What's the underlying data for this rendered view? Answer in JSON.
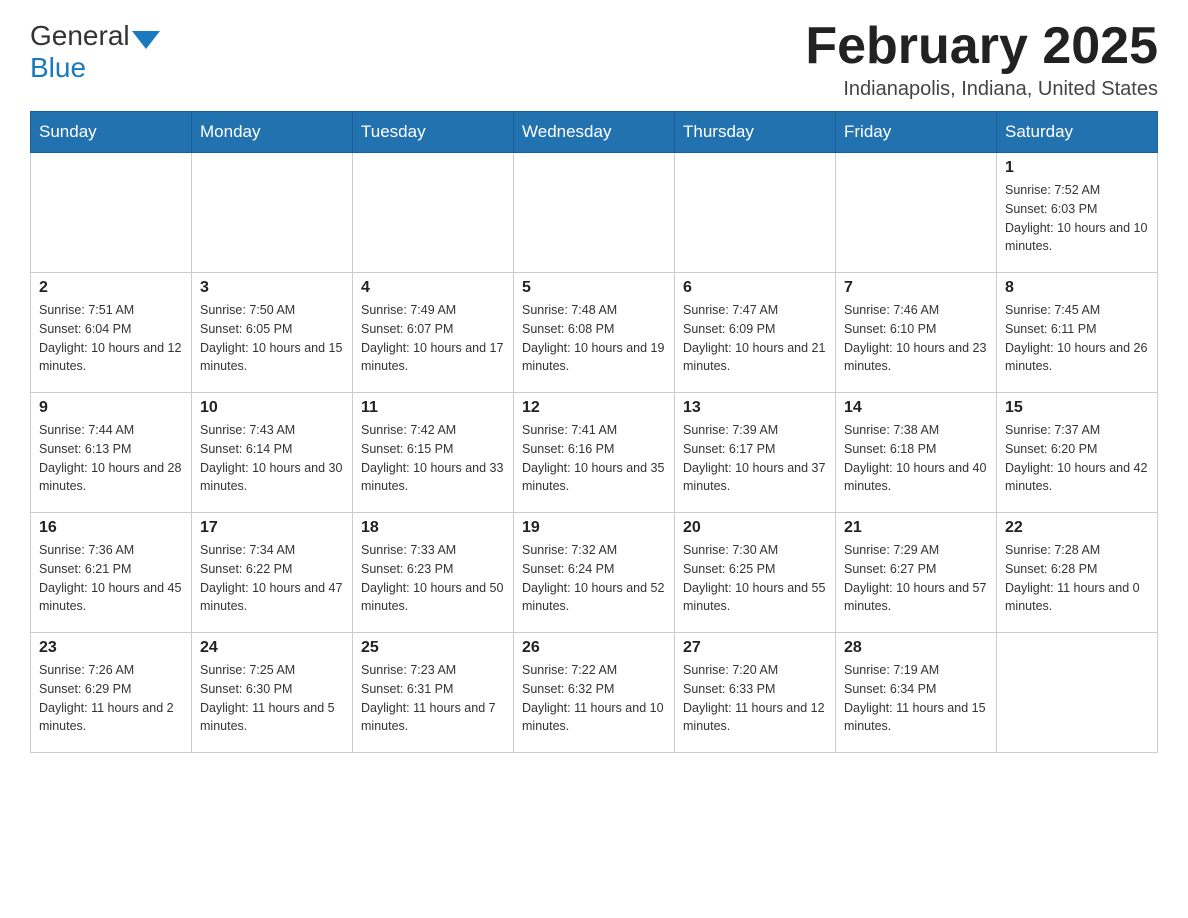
{
  "header": {
    "logo_general": "General",
    "logo_blue": "Blue",
    "month_title": "February 2025",
    "location": "Indianapolis, Indiana, United States"
  },
  "weekdays": [
    "Sunday",
    "Monday",
    "Tuesday",
    "Wednesday",
    "Thursday",
    "Friday",
    "Saturday"
  ],
  "weeks": [
    [
      {
        "day": "",
        "sunrise": "",
        "sunset": "",
        "daylight": ""
      },
      {
        "day": "",
        "sunrise": "",
        "sunset": "",
        "daylight": ""
      },
      {
        "day": "",
        "sunrise": "",
        "sunset": "",
        "daylight": ""
      },
      {
        "day": "",
        "sunrise": "",
        "sunset": "",
        "daylight": ""
      },
      {
        "day": "",
        "sunrise": "",
        "sunset": "",
        "daylight": ""
      },
      {
        "day": "",
        "sunrise": "",
        "sunset": "",
        "daylight": ""
      },
      {
        "day": "1",
        "sunrise": "Sunrise: 7:52 AM",
        "sunset": "Sunset: 6:03 PM",
        "daylight": "Daylight: 10 hours and 10 minutes."
      }
    ],
    [
      {
        "day": "2",
        "sunrise": "Sunrise: 7:51 AM",
        "sunset": "Sunset: 6:04 PM",
        "daylight": "Daylight: 10 hours and 12 minutes."
      },
      {
        "day": "3",
        "sunrise": "Sunrise: 7:50 AM",
        "sunset": "Sunset: 6:05 PM",
        "daylight": "Daylight: 10 hours and 15 minutes."
      },
      {
        "day": "4",
        "sunrise": "Sunrise: 7:49 AM",
        "sunset": "Sunset: 6:07 PM",
        "daylight": "Daylight: 10 hours and 17 minutes."
      },
      {
        "day": "5",
        "sunrise": "Sunrise: 7:48 AM",
        "sunset": "Sunset: 6:08 PM",
        "daylight": "Daylight: 10 hours and 19 minutes."
      },
      {
        "day": "6",
        "sunrise": "Sunrise: 7:47 AM",
        "sunset": "Sunset: 6:09 PM",
        "daylight": "Daylight: 10 hours and 21 minutes."
      },
      {
        "day": "7",
        "sunrise": "Sunrise: 7:46 AM",
        "sunset": "Sunset: 6:10 PM",
        "daylight": "Daylight: 10 hours and 23 minutes."
      },
      {
        "day": "8",
        "sunrise": "Sunrise: 7:45 AM",
        "sunset": "Sunset: 6:11 PM",
        "daylight": "Daylight: 10 hours and 26 minutes."
      }
    ],
    [
      {
        "day": "9",
        "sunrise": "Sunrise: 7:44 AM",
        "sunset": "Sunset: 6:13 PM",
        "daylight": "Daylight: 10 hours and 28 minutes."
      },
      {
        "day": "10",
        "sunrise": "Sunrise: 7:43 AM",
        "sunset": "Sunset: 6:14 PM",
        "daylight": "Daylight: 10 hours and 30 minutes."
      },
      {
        "day": "11",
        "sunrise": "Sunrise: 7:42 AM",
        "sunset": "Sunset: 6:15 PM",
        "daylight": "Daylight: 10 hours and 33 minutes."
      },
      {
        "day": "12",
        "sunrise": "Sunrise: 7:41 AM",
        "sunset": "Sunset: 6:16 PM",
        "daylight": "Daylight: 10 hours and 35 minutes."
      },
      {
        "day": "13",
        "sunrise": "Sunrise: 7:39 AM",
        "sunset": "Sunset: 6:17 PM",
        "daylight": "Daylight: 10 hours and 37 minutes."
      },
      {
        "day": "14",
        "sunrise": "Sunrise: 7:38 AM",
        "sunset": "Sunset: 6:18 PM",
        "daylight": "Daylight: 10 hours and 40 minutes."
      },
      {
        "day": "15",
        "sunrise": "Sunrise: 7:37 AM",
        "sunset": "Sunset: 6:20 PM",
        "daylight": "Daylight: 10 hours and 42 minutes."
      }
    ],
    [
      {
        "day": "16",
        "sunrise": "Sunrise: 7:36 AM",
        "sunset": "Sunset: 6:21 PM",
        "daylight": "Daylight: 10 hours and 45 minutes."
      },
      {
        "day": "17",
        "sunrise": "Sunrise: 7:34 AM",
        "sunset": "Sunset: 6:22 PM",
        "daylight": "Daylight: 10 hours and 47 minutes."
      },
      {
        "day": "18",
        "sunrise": "Sunrise: 7:33 AM",
        "sunset": "Sunset: 6:23 PM",
        "daylight": "Daylight: 10 hours and 50 minutes."
      },
      {
        "day": "19",
        "sunrise": "Sunrise: 7:32 AM",
        "sunset": "Sunset: 6:24 PM",
        "daylight": "Daylight: 10 hours and 52 minutes."
      },
      {
        "day": "20",
        "sunrise": "Sunrise: 7:30 AM",
        "sunset": "Sunset: 6:25 PM",
        "daylight": "Daylight: 10 hours and 55 minutes."
      },
      {
        "day": "21",
        "sunrise": "Sunrise: 7:29 AM",
        "sunset": "Sunset: 6:27 PM",
        "daylight": "Daylight: 10 hours and 57 minutes."
      },
      {
        "day": "22",
        "sunrise": "Sunrise: 7:28 AM",
        "sunset": "Sunset: 6:28 PM",
        "daylight": "Daylight: 11 hours and 0 minutes."
      }
    ],
    [
      {
        "day": "23",
        "sunrise": "Sunrise: 7:26 AM",
        "sunset": "Sunset: 6:29 PM",
        "daylight": "Daylight: 11 hours and 2 minutes."
      },
      {
        "day": "24",
        "sunrise": "Sunrise: 7:25 AM",
        "sunset": "Sunset: 6:30 PM",
        "daylight": "Daylight: 11 hours and 5 minutes."
      },
      {
        "day": "25",
        "sunrise": "Sunrise: 7:23 AM",
        "sunset": "Sunset: 6:31 PM",
        "daylight": "Daylight: 11 hours and 7 minutes."
      },
      {
        "day": "26",
        "sunrise": "Sunrise: 7:22 AM",
        "sunset": "Sunset: 6:32 PM",
        "daylight": "Daylight: 11 hours and 10 minutes."
      },
      {
        "day": "27",
        "sunrise": "Sunrise: 7:20 AM",
        "sunset": "Sunset: 6:33 PM",
        "daylight": "Daylight: 11 hours and 12 minutes."
      },
      {
        "day": "28",
        "sunrise": "Sunrise: 7:19 AM",
        "sunset": "Sunset: 6:34 PM",
        "daylight": "Daylight: 11 hours and 15 minutes."
      },
      {
        "day": "",
        "sunrise": "",
        "sunset": "",
        "daylight": ""
      }
    ]
  ]
}
